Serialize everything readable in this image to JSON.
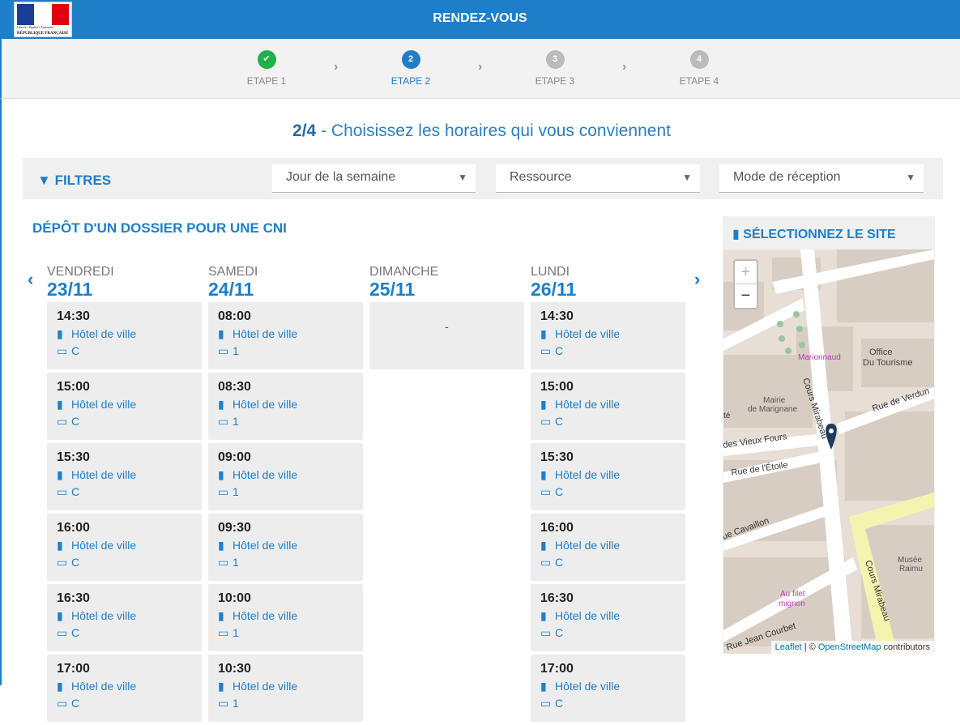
{
  "logo": {
    "motto": "Liberté • Égalité • Fraternité",
    "country": "RÉPUBLIQUE FRANÇAISE"
  },
  "header": {
    "title": "RENDEZ-VOUS"
  },
  "steps": [
    {
      "label": "ETAPE 1",
      "number": "✔",
      "state": "done",
      "color": "#22b04b"
    },
    {
      "label": "ETAPE 2",
      "number": "2",
      "state": "active",
      "color": "#1e7ec8"
    },
    {
      "label": "ETAPE 3",
      "number": "3",
      "state": "pending",
      "color": "#bbbbbb"
    },
    {
      "label": "ETAPE 4",
      "number": "4",
      "state": "pending",
      "color": "#bbbbbb"
    }
  ],
  "page": {
    "step": "2/4",
    "title": "- Choisissez les horaires qui vous conviennent"
  },
  "filters": {
    "label": "FILTRES",
    "day": "Jour de la semaine",
    "resource": "Ressource",
    "mode": "Mode de réception"
  },
  "section": {
    "title": "DÉPÔT D'UN DOSSIER POUR UNE CNI"
  },
  "days": [
    {
      "name": "VENDREDI",
      "date": "23/11",
      "slots": [
        {
          "time": "14:30",
          "site": "Hôtel de ville",
          "mode": "C"
        },
        {
          "time": "15:00",
          "site": "Hôtel de ville",
          "mode": "C"
        },
        {
          "time": "15:30",
          "site": "Hôtel de ville",
          "mode": "C"
        },
        {
          "time": "16:00",
          "site": "Hôtel de ville",
          "mode": "C"
        },
        {
          "time": "16:30",
          "site": "Hôtel de ville",
          "mode": "C"
        },
        {
          "time": "17:00",
          "site": "Hôtel de ville",
          "mode": "C"
        }
      ]
    },
    {
      "name": "SAMEDI",
      "date": "24/11",
      "slots": [
        {
          "time": "08:00",
          "site": "Hôtel de ville",
          "mode": "1"
        },
        {
          "time": "08:30",
          "site": "Hôtel de ville",
          "mode": "1"
        },
        {
          "time": "09:00",
          "site": "Hôtel de ville",
          "mode": "1"
        },
        {
          "time": "09:30",
          "site": "Hôtel de ville",
          "mode": "1"
        },
        {
          "time": "10:00",
          "site": "Hôtel de ville",
          "mode": "1"
        },
        {
          "time": "10:30",
          "site": "Hôtel de ville",
          "mode": "1"
        }
      ]
    },
    {
      "name": "DIMANCHE",
      "date": "25/11",
      "empty": "-"
    },
    {
      "name": "LUNDI",
      "date": "26/11",
      "slots": [
        {
          "time": "14:30",
          "site": "Hôtel de ville",
          "mode": "C"
        },
        {
          "time": "15:00",
          "site": "Hôtel de ville",
          "mode": "C"
        },
        {
          "time": "15:30",
          "site": "Hôtel de ville",
          "mode": "C"
        },
        {
          "time": "16:00",
          "site": "Hôtel de ville",
          "mode": "C"
        },
        {
          "time": "16:30",
          "site": "Hôtel de ville",
          "mode": "C"
        },
        {
          "time": "17:00",
          "site": "Hôtel de ville",
          "mode": "C"
        }
      ]
    }
  ],
  "map": {
    "title": "SÉLECTIONNEZ LE SITE",
    "zoom_in": "+",
    "zoom_out": "−",
    "attribution_leaflet": "Leaflet",
    "attribution_sep": " | © ",
    "attribution_osm": "OpenStreetMap",
    "attribution_tail": " contributors",
    "labels": [
      "Marionnaud",
      "Office",
      "Du Tourisme",
      "Mairie",
      "de Marignane",
      "Cours Mirabeau",
      "Rue de Verdun",
      "des Vieux Fours",
      "Rue de l'Étoile",
      "ue Cavaillon",
      "Musée",
      "Raimu",
      "Cours Mirabeau",
      "Au filet",
      "mignon",
      "Rue Jean Courbet",
      "té"
    ]
  }
}
